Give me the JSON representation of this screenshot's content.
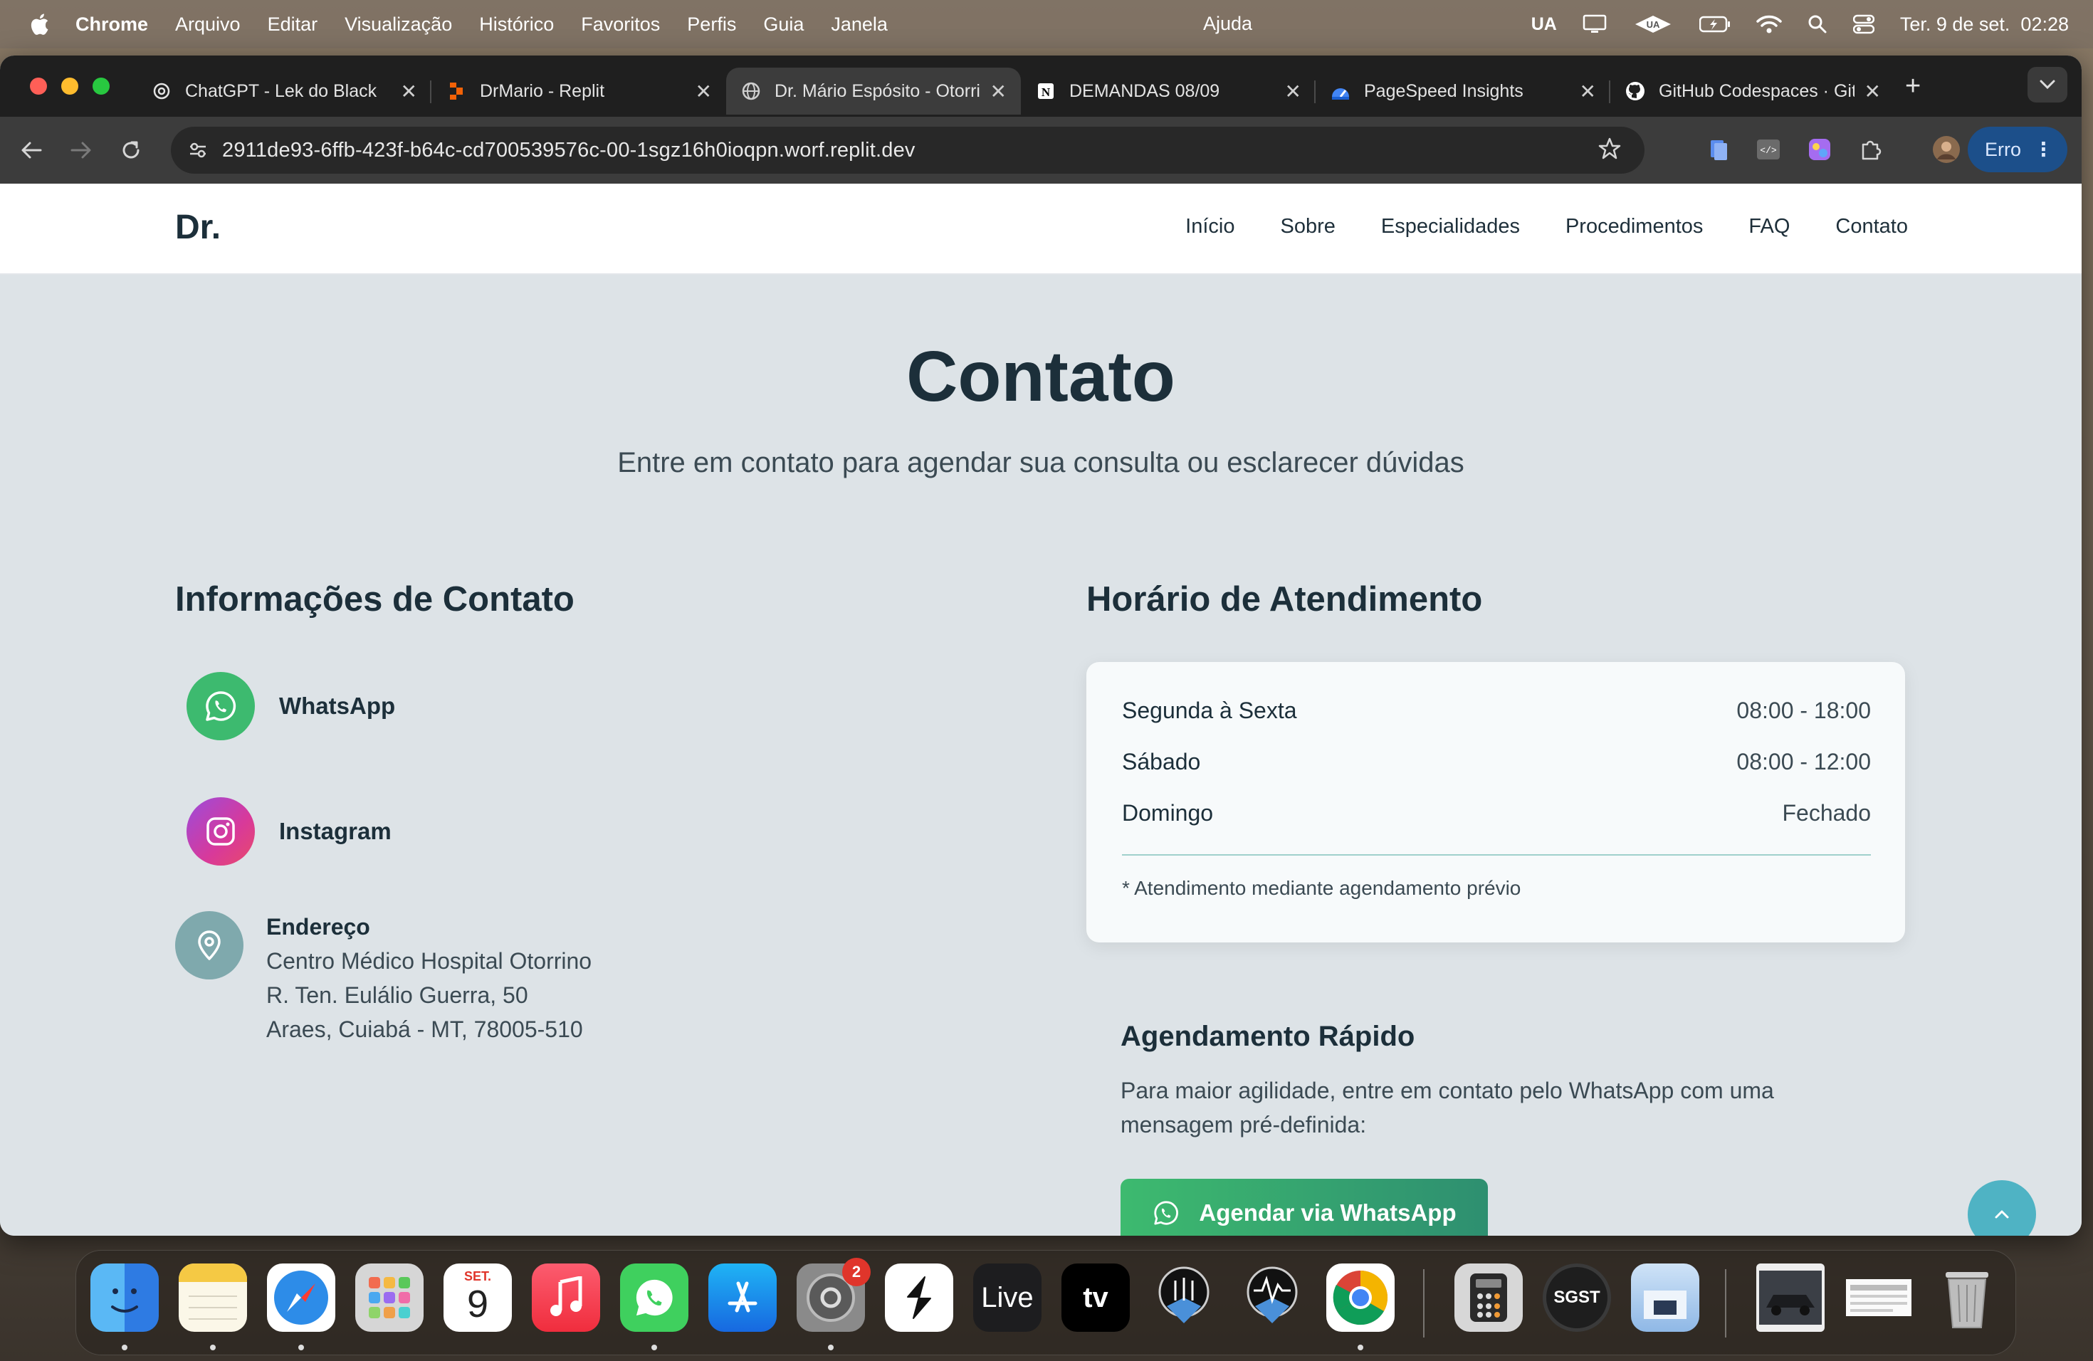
{
  "menubar": {
    "app": "Chrome",
    "items": [
      "Arquivo",
      "Editar",
      "Visualização",
      "Histórico",
      "Favoritos",
      "Perfis",
      "Guia",
      "Janela"
    ],
    "help": "Ajuda",
    "input_source": "UA",
    "datetime": "Ter. 9 de set.  02:28"
  },
  "browser": {
    "tabs": [
      {
        "title": "ChatGPT - Lek do Black",
        "icon": "chatgpt-icon"
      },
      {
        "title": "DrMario - Replit",
        "icon": "replit-icon"
      },
      {
        "title": "Dr. Mário Espósito - Otorrino",
        "icon": "globe-icon",
        "active": true
      },
      {
        "title": "DEMANDAS 08/09",
        "icon": "notion-icon"
      },
      {
        "title": "PageSpeed Insights",
        "icon": "pagespeed-icon"
      },
      {
        "title": "GitHub Codespaces · GitHub",
        "icon": "github-icon"
      }
    ],
    "close_glyph": "✕",
    "new_tab": "+",
    "url": "2911de93-6ffb-423f-b64c-cd700539576c-00-1sgz16h0ioqpn.worf.replit.dev",
    "error_button": "Erro"
  },
  "site": {
    "logo": "Dr.",
    "nav": [
      "Início",
      "Sobre",
      "Especialidades",
      "Procedimentos",
      "FAQ",
      "Contato"
    ],
    "section_title": "Contato",
    "section_subtitle": "Entre em contato para agendar sua consulta ou esclarecer dúvidas",
    "contact_info": {
      "title": "Informações de Contato",
      "whatsapp": "WhatsApp",
      "instagram": "Instagram",
      "address_label": "Endereço",
      "address_lines": [
        "Centro Médico Hospital Otorrino",
        "R. Ten. Eulálio Guerra, 50",
        "Araes, Cuiabá - MT, 78005-510"
      ]
    },
    "hours": {
      "title": "Horário de Atendimento",
      "rows": [
        {
          "day": "Segunda à Sexta",
          "time": "08:00 - 18:00"
        },
        {
          "day": "Sábado",
          "time": "08:00 - 12:00"
        },
        {
          "day": "Domingo",
          "time": "Fechado"
        }
      ],
      "note": "* Atendimento mediante agendamento prévio"
    },
    "quick": {
      "title": "Agendamento Rápido",
      "text": "Para maior agilidade, entre em contato pelo WhatsApp com uma mensagem pré-definida:",
      "button": "Agendar via WhatsApp"
    }
  },
  "dock": {
    "calendar_month": "SET.",
    "calendar_day": "9",
    "settings_badge": "2",
    "live_label": "Live",
    "tv_label": "tv",
    "sgst_label": "SGST"
  },
  "colors": {
    "accent_teal": "#4fb3c4",
    "whatsapp_green": "#3dba6f",
    "heading": "#1c2f3a",
    "page_bg": "#dde3e7"
  }
}
